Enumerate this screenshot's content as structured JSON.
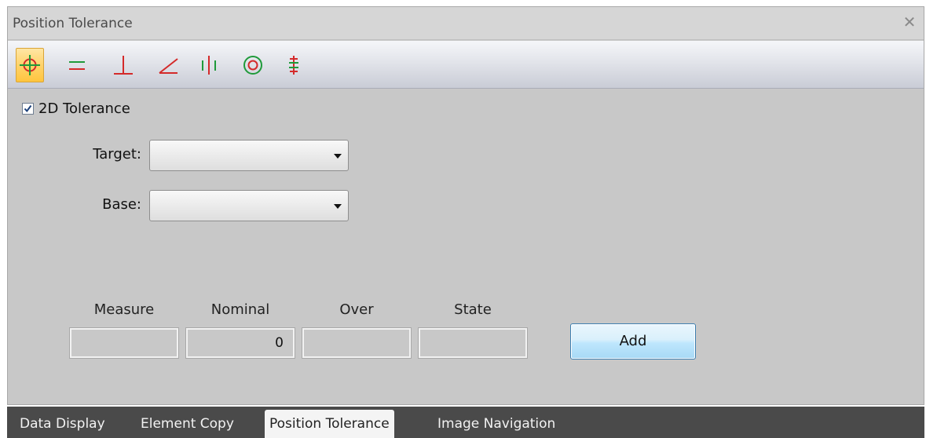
{
  "window": {
    "title": "Position Tolerance",
    "close_glyph": "✕"
  },
  "toolbar": {
    "tools": [
      {
        "name": "position-tolerance-icon",
        "active": true
      },
      {
        "name": "parallelism-icon",
        "active": false
      },
      {
        "name": "perpendicularity-icon",
        "active": false
      },
      {
        "name": "angularity-icon",
        "active": false
      },
      {
        "name": "symmetry-icon",
        "active": false
      },
      {
        "name": "concentricity-icon",
        "active": false
      },
      {
        "name": "coaxiality-icon",
        "active": false
      }
    ]
  },
  "form": {
    "tolerance_2d": {
      "label": "2D Tolerance",
      "checked": true
    },
    "target": {
      "label": "Target:",
      "value": ""
    },
    "base": {
      "label": "Base:",
      "value": ""
    }
  },
  "results": {
    "measure": {
      "label": "Measure",
      "value": ""
    },
    "nominal": {
      "label": "Nominal",
      "value": "0"
    },
    "over": {
      "label": "Over",
      "value": ""
    },
    "state": {
      "label": "State",
      "value": ""
    },
    "add_label": "Add"
  },
  "tabs": [
    {
      "label": "Data Display",
      "active": false
    },
    {
      "label": "Element Copy",
      "active": false
    },
    {
      "label": "Position Tolerance",
      "active": true
    },
    {
      "label": "Image Navigation",
      "active": false
    }
  ],
  "colors": {
    "icon_red": "#d42a2a",
    "icon_green": "#1f9a3a",
    "accent_active": "#ffd36b"
  }
}
